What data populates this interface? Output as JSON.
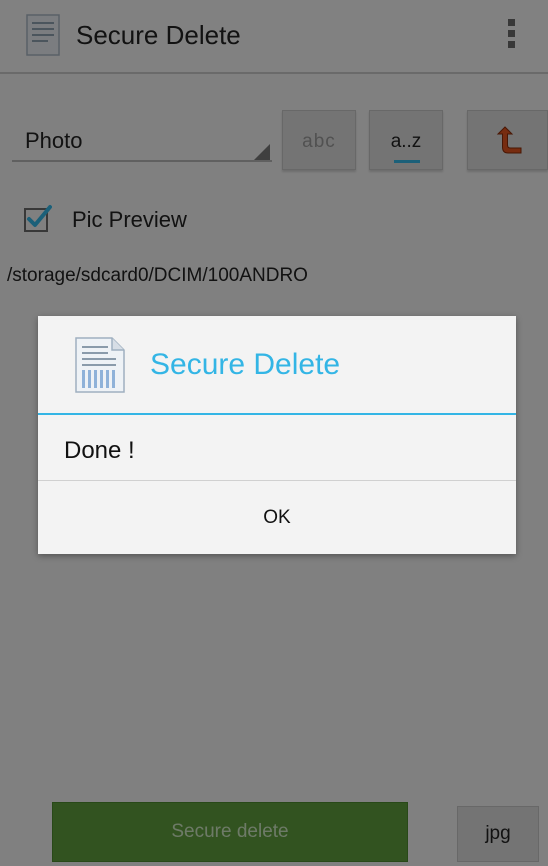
{
  "app": {
    "title": "Secure Delete",
    "spinner_value": "Photo",
    "sort_buttons": {
      "alpha_label": "abc",
      "az_label": "a..z"
    },
    "pic_preview": {
      "label": "Pic Preview",
      "checked": true
    },
    "path": "/storage/sdcard0/DCIM/100ANDRO",
    "bottom": {
      "secure_delete_label": "Secure delete",
      "extension_label": "jpg"
    }
  },
  "dialog": {
    "title": "Secure Delete",
    "message": "Done !",
    "ok_label": "OK"
  },
  "colors": {
    "accent": "#33b5e5",
    "primary_button": "#5f9e3e",
    "up_arrow": "#e0531f"
  },
  "icons": {
    "app": "document-shredder-icon",
    "overflow": "overflow-menu-icon",
    "up": "up-level-arrow-icon",
    "dialog": "document-shredder-icon",
    "checkbox": "checkmark-icon"
  }
}
